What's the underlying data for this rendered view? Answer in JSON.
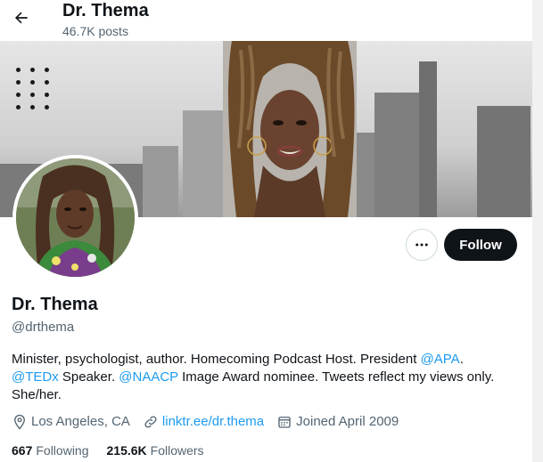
{
  "header": {
    "name": "Dr. Thema",
    "posts": "46.7K posts",
    "back_icon": "arrow-left-icon"
  },
  "banner": {
    "dots_icon": "grid-dots-icon"
  },
  "profile": {
    "display_name": "Dr. Thema",
    "handle": "@drthema",
    "follow_label": "Follow",
    "more_icon": "more-dots-icon"
  },
  "bio": {
    "part1": "Minister, psychologist, author. Homecoming Podcast Host. President ",
    "mention1": "@APA",
    "part2": ". ",
    "mention2": "@TEDx",
    "part3": " Speaker. ",
    "mention3": "@NAACP",
    "part4": " Image Award nominee. Tweets reflect my views only. She/her."
  },
  "meta": {
    "location": "Los Angeles, CA",
    "link": "linktr.ee/dr.thema",
    "joined": "Joined April 2009"
  },
  "stats": {
    "following_count": "667",
    "following_label": "Following",
    "followers_count": "215.6K",
    "followers_label": "Followers"
  },
  "colors": {
    "accent": "#1d9bf0",
    "text": "#0f1419",
    "muted": "#536471",
    "follow_bg": "#0f1419"
  }
}
